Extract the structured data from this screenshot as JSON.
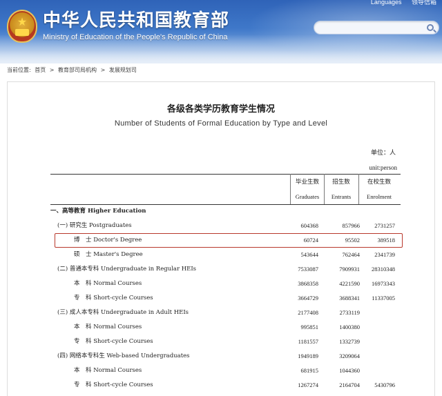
{
  "header": {
    "site_title": "中华人民共和国教育部",
    "site_subtitle": "Ministry of Education of the People's Republic of China",
    "top_links": [
      "Languages",
      "领导信箱"
    ],
    "search": {
      "placeholder": "",
      "value": ""
    }
  },
  "breadcrumb": {
    "prefix": "当前位置:",
    "items": [
      "首页",
      "教育部司局机构",
      "发展规划司"
    ],
    "separator": ">"
  },
  "document": {
    "title": "各级各类学历教育学生情况",
    "subtitle": "Number of Students of Formal Education by Type and Level",
    "unit_cn": "单位：人",
    "unit_en": "unit:person",
    "columns": [
      {
        "cn": "毕业生数",
        "en": "Graduates"
      },
      {
        "cn": "招生数",
        "en": "Entrants"
      },
      {
        "cn": "在校生数",
        "en": "Enrolment"
      }
    ],
    "section_title": "一、高等教育 Higher Education",
    "rows": [
      {
        "label": "(一) 研究生 Postgraduates",
        "values": [
          "604368",
          "857966",
          "2731257"
        ]
      },
      {
        "label": "博　士 Doctor's Degree",
        "values": [
          "60724",
          "95502",
          "389518"
        ]
      },
      {
        "label": "硕　士 Master's Degree",
        "values": [
          "543644",
          "762464",
          "2341739"
        ]
      },
      {
        "label": "(二) 普通本专科 Undergraduate in Regular HEIs",
        "values": [
          "7533087",
          "7909931",
          "28310348"
        ]
      },
      {
        "label": "本　科 Normal Courses",
        "values": [
          "3868358",
          "4221590",
          "16973343"
        ]
      },
      {
        "label": "专　科 Short-cycle Courses",
        "values": [
          "3664729",
          "3688341",
          "11337005"
        ]
      },
      {
        "label": "(三) 成人本专科 Undergraduate in Adult HEIs",
        "values": [
          "2177408",
          "2733119",
          ""
        ]
      },
      {
        "label": "本　科 Normal Courses",
        "values": [
          "995851",
          "1400380",
          ""
        ]
      },
      {
        "label": "专　科 Short-cycle Courses",
        "values": [
          "1181557",
          "1332739",
          ""
        ]
      },
      {
        "label": "(四) 网络本专科生 Web-based Undergraduates",
        "values": [
          "1949189",
          "3209064",
          ""
        ]
      },
      {
        "label": "本　科 Normal Courses",
        "values": [
          "681915",
          "1044360",
          ""
        ]
      },
      {
        "label": "专　科 Short-cycle Courses",
        "values": [
          "1267274",
          "2164704",
          "5430796"
        ]
      }
    ],
    "highlight_color": "#b8362a"
  },
  "colors": {
    "banner_blue": "#2f63b8",
    "text": "#222222"
  }
}
